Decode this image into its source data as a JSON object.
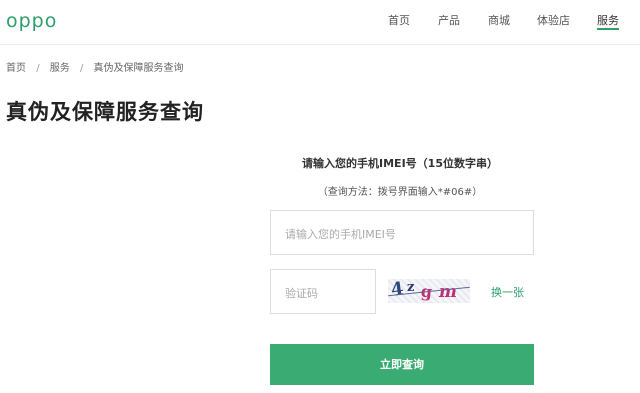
{
  "header": {
    "logo_text": "oppo",
    "nav": [
      {
        "label": "首页"
      },
      {
        "label": "产品"
      },
      {
        "label": "商城"
      },
      {
        "label": "体验店"
      },
      {
        "label": "服务",
        "active": true
      }
    ]
  },
  "breadcrumb": {
    "items": [
      "首页",
      "服务",
      "真伪及保障服务查询"
    ],
    "separator": "/"
  },
  "page_title": "真伪及保障服务查询",
  "form": {
    "prompt": "请输入您的手机IMEI号（15位数字串）",
    "hint": "（查询方法：拨号界面输入*#06#）",
    "imei_placeholder": "请输入您的手机IMEI号",
    "code_placeholder": "验证码",
    "captcha_text": "4zgm",
    "captcha_chars": [
      "4",
      "z",
      "g",
      "m"
    ],
    "refresh_label": "换一张",
    "submit_label": "立即查询"
  },
  "colors": {
    "brand_green": "#2e9f6b",
    "button_green": "#3aab72"
  }
}
